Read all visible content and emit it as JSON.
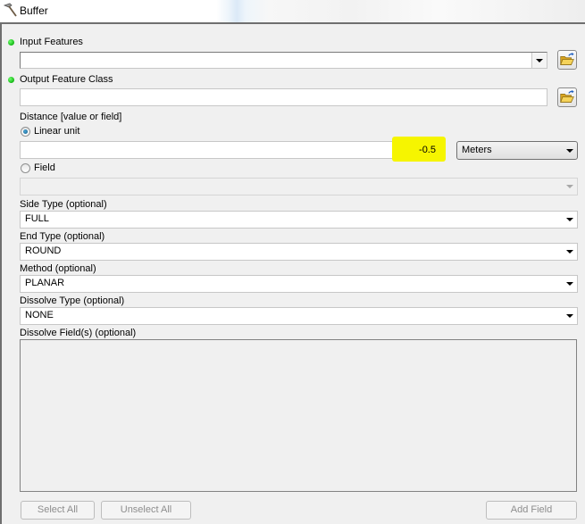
{
  "window": {
    "title": "Buffer",
    "icon": "hammer-icon"
  },
  "params": {
    "input_features": {
      "label": "Input Features",
      "required": true,
      "value": "",
      "browse_icon": "open-folder-icon"
    },
    "output_feature_class": {
      "label": "Output Feature Class",
      "required": true,
      "value": "",
      "browse_icon": "open-folder-icon"
    },
    "distance": {
      "label": "Distance [value or field]",
      "mode_options": [
        {
          "label": "Linear unit",
          "selected": true
        },
        {
          "label": "Field",
          "selected": false
        }
      ],
      "linear_value": "-0.5",
      "linear_value_highlight": "#f6f500",
      "units": "Meters",
      "field_value": ""
    },
    "side_type": {
      "label": "Side Type (optional)",
      "value": "FULL"
    },
    "end_type": {
      "label": "End Type (optional)",
      "value": "ROUND"
    },
    "method": {
      "label": "Method (optional)",
      "value": "PLANAR"
    },
    "dissolve_type": {
      "label": "Dissolve Type (optional)",
      "value": "NONE"
    },
    "dissolve_fields": {
      "label": "Dissolve Field(s) (optional)",
      "items": []
    }
  },
  "buttons": {
    "select_all": "Select All",
    "unselect_all": "Unselect All",
    "add_field": "Add Field"
  },
  "colors": {
    "required_dot": "#16b716",
    "highlight": "#f6f500",
    "disabled_text": "#8d8d8d"
  }
}
